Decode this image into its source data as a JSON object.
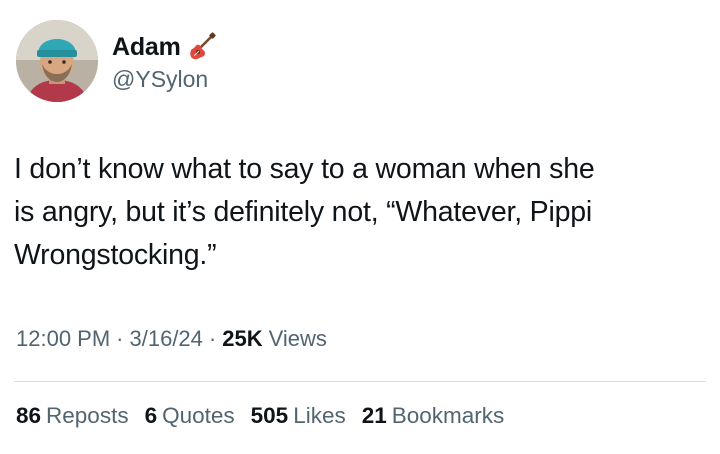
{
  "author": {
    "display_name": "Adam",
    "handle": "@YSylon",
    "badge_icon": "guitar-emoji-icon",
    "avatar_icon": "profile-photo-avatar"
  },
  "tweet": {
    "text_line1": "I don’t know what to say to a woman when she",
    "text_line2": "is angry, but it’s definitely not, “Whatever, Pippi",
    "text_line3": "Wrongstocking.”"
  },
  "meta": {
    "time": "12:00 PM",
    "date": "3/16/24",
    "views_count": "25K",
    "views_label": "Views",
    "separator": "·"
  },
  "stats": {
    "reposts_count": "86",
    "reposts_label": "Reposts",
    "quotes_count": "6",
    "quotes_label": "Quotes",
    "likes_count": "505",
    "likes_label": "Likes",
    "bookmarks_count": "21",
    "bookmarks_label": "Bookmarks"
  },
  "colors": {
    "text_primary": "#0f1419",
    "text_secondary": "#536471",
    "divider": "#d6dbdf"
  }
}
